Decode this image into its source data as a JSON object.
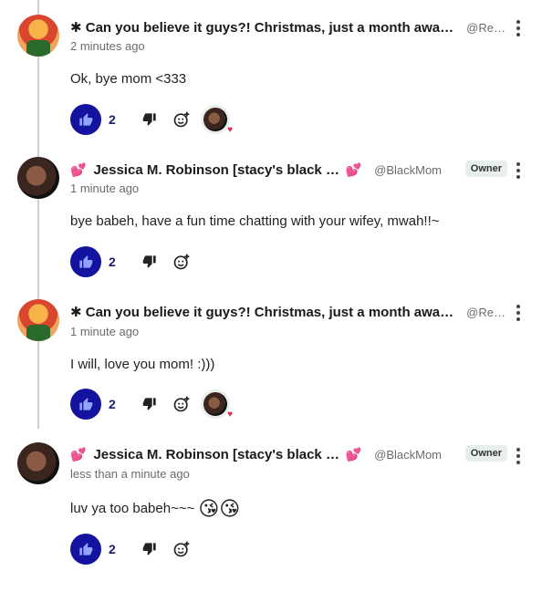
{
  "comments": [
    {
      "name": "✱ Can you believe it guys?! Christmas, just a month away! ✱",
      "handle": "@Re…",
      "time": "2 minutes ago",
      "text": "Ok, bye mom <333",
      "likes": "2",
      "owner": ""
    },
    {
      "name": "Jessica M. Robinson [stacy's black mom]",
      "heart": "💕",
      "handle": "@BlackMom",
      "time": "1 minute ago",
      "text": "bye babeh, have a fun time chatting with your wifey, mwah!!~",
      "likes": "2",
      "owner": "Owner"
    },
    {
      "name": "✱ Can you believe it guys?! Christmas, just a month away! ✱",
      "handle": "@Re…",
      "time": "1 minute ago",
      "text": "I will, love you mom! :)))",
      "likes": "2",
      "owner": ""
    },
    {
      "name": "Jessica M. Robinson [stacy's black mom]",
      "heart": "💕",
      "handle": "@BlackMom",
      "time": "less than a minute ago",
      "text": "luv ya too babeh~~~",
      "emojis": "😘😘",
      "likes": "2",
      "owner": "Owner"
    }
  ],
  "icons": {
    "like": "thumbs-up-icon",
    "dislike": "thumbs-down-icon",
    "react": "add-reaction-icon",
    "menu": "more-vertical-icon"
  },
  "colors": {
    "like_button": "#1313a0",
    "owner_badge_bg": "#e6efe9",
    "heart": "#e83e8c"
  }
}
